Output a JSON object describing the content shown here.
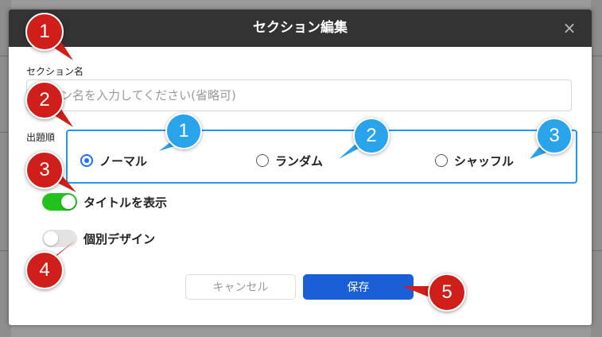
{
  "dialog": {
    "title": "セクション編集",
    "close_label": "×"
  },
  "section_name": {
    "label": "セクション名",
    "placeholder": "ション名を入力してください(省略可)"
  },
  "order": {
    "label": "出題順",
    "options": [
      {
        "label": "ノーマル",
        "selected": true
      },
      {
        "label": "ランダム",
        "selected": false
      },
      {
        "label": "シャッフル",
        "selected": false
      }
    ]
  },
  "toggles": {
    "show_title": {
      "label": "タイトルを表示",
      "on": true
    },
    "individual_design": {
      "label": "個別デザイン",
      "on": false
    }
  },
  "buttons": {
    "cancel": "キャンセル",
    "save": "保存"
  },
  "callouts": {
    "red": [
      "1",
      "2",
      "3",
      "4",
      "5"
    ],
    "blue": [
      "1",
      "2",
      "3"
    ]
  },
  "colors": {
    "accent": "#1a5fd6",
    "toggle_on": "#22c21d",
    "callout_red": "#d01f1a",
    "callout_blue": "#29a3ea",
    "focus_border": "#2196f3"
  }
}
